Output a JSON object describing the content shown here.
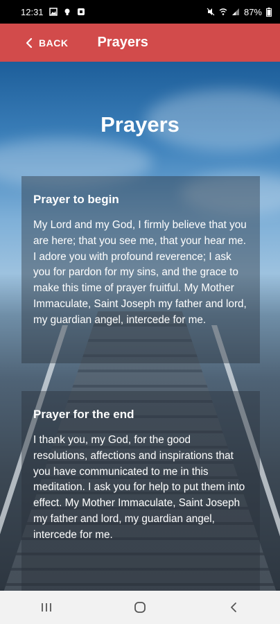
{
  "status_bar": {
    "time": "12:31",
    "battery": "87%"
  },
  "app_bar": {
    "back_label": "BACK",
    "title": "Prayers",
    "color": "#d24b4b"
  },
  "page": {
    "title": "Prayers"
  },
  "prayers": [
    {
      "title": "Prayer to begin",
      "text": "My Lord and my God, I firmly believe that you are here; that you see me, that your hear me. I adore you with profound reverence; I ask you for pardon for my sins, and the grace to make this time of prayer fruitful. My Mother Immaculate, Saint Joseph my father and lord, my guardian angel, intercede for me."
    },
    {
      "title": "Prayer for the end",
      "text": "I thank you, my God, for the good resolutions, affections and inspirations that you have communicated to me in this meditation. I ask you for help to put them into effect. My Mother Immaculate, Saint Joseph my father and lord, my guardian angel, intercede for me."
    }
  ],
  "icons": {
    "back": "chevron-left-icon",
    "nav_recents": "recents-icon",
    "nav_home": "home-icon",
    "nav_back": "nav-back-icon"
  }
}
